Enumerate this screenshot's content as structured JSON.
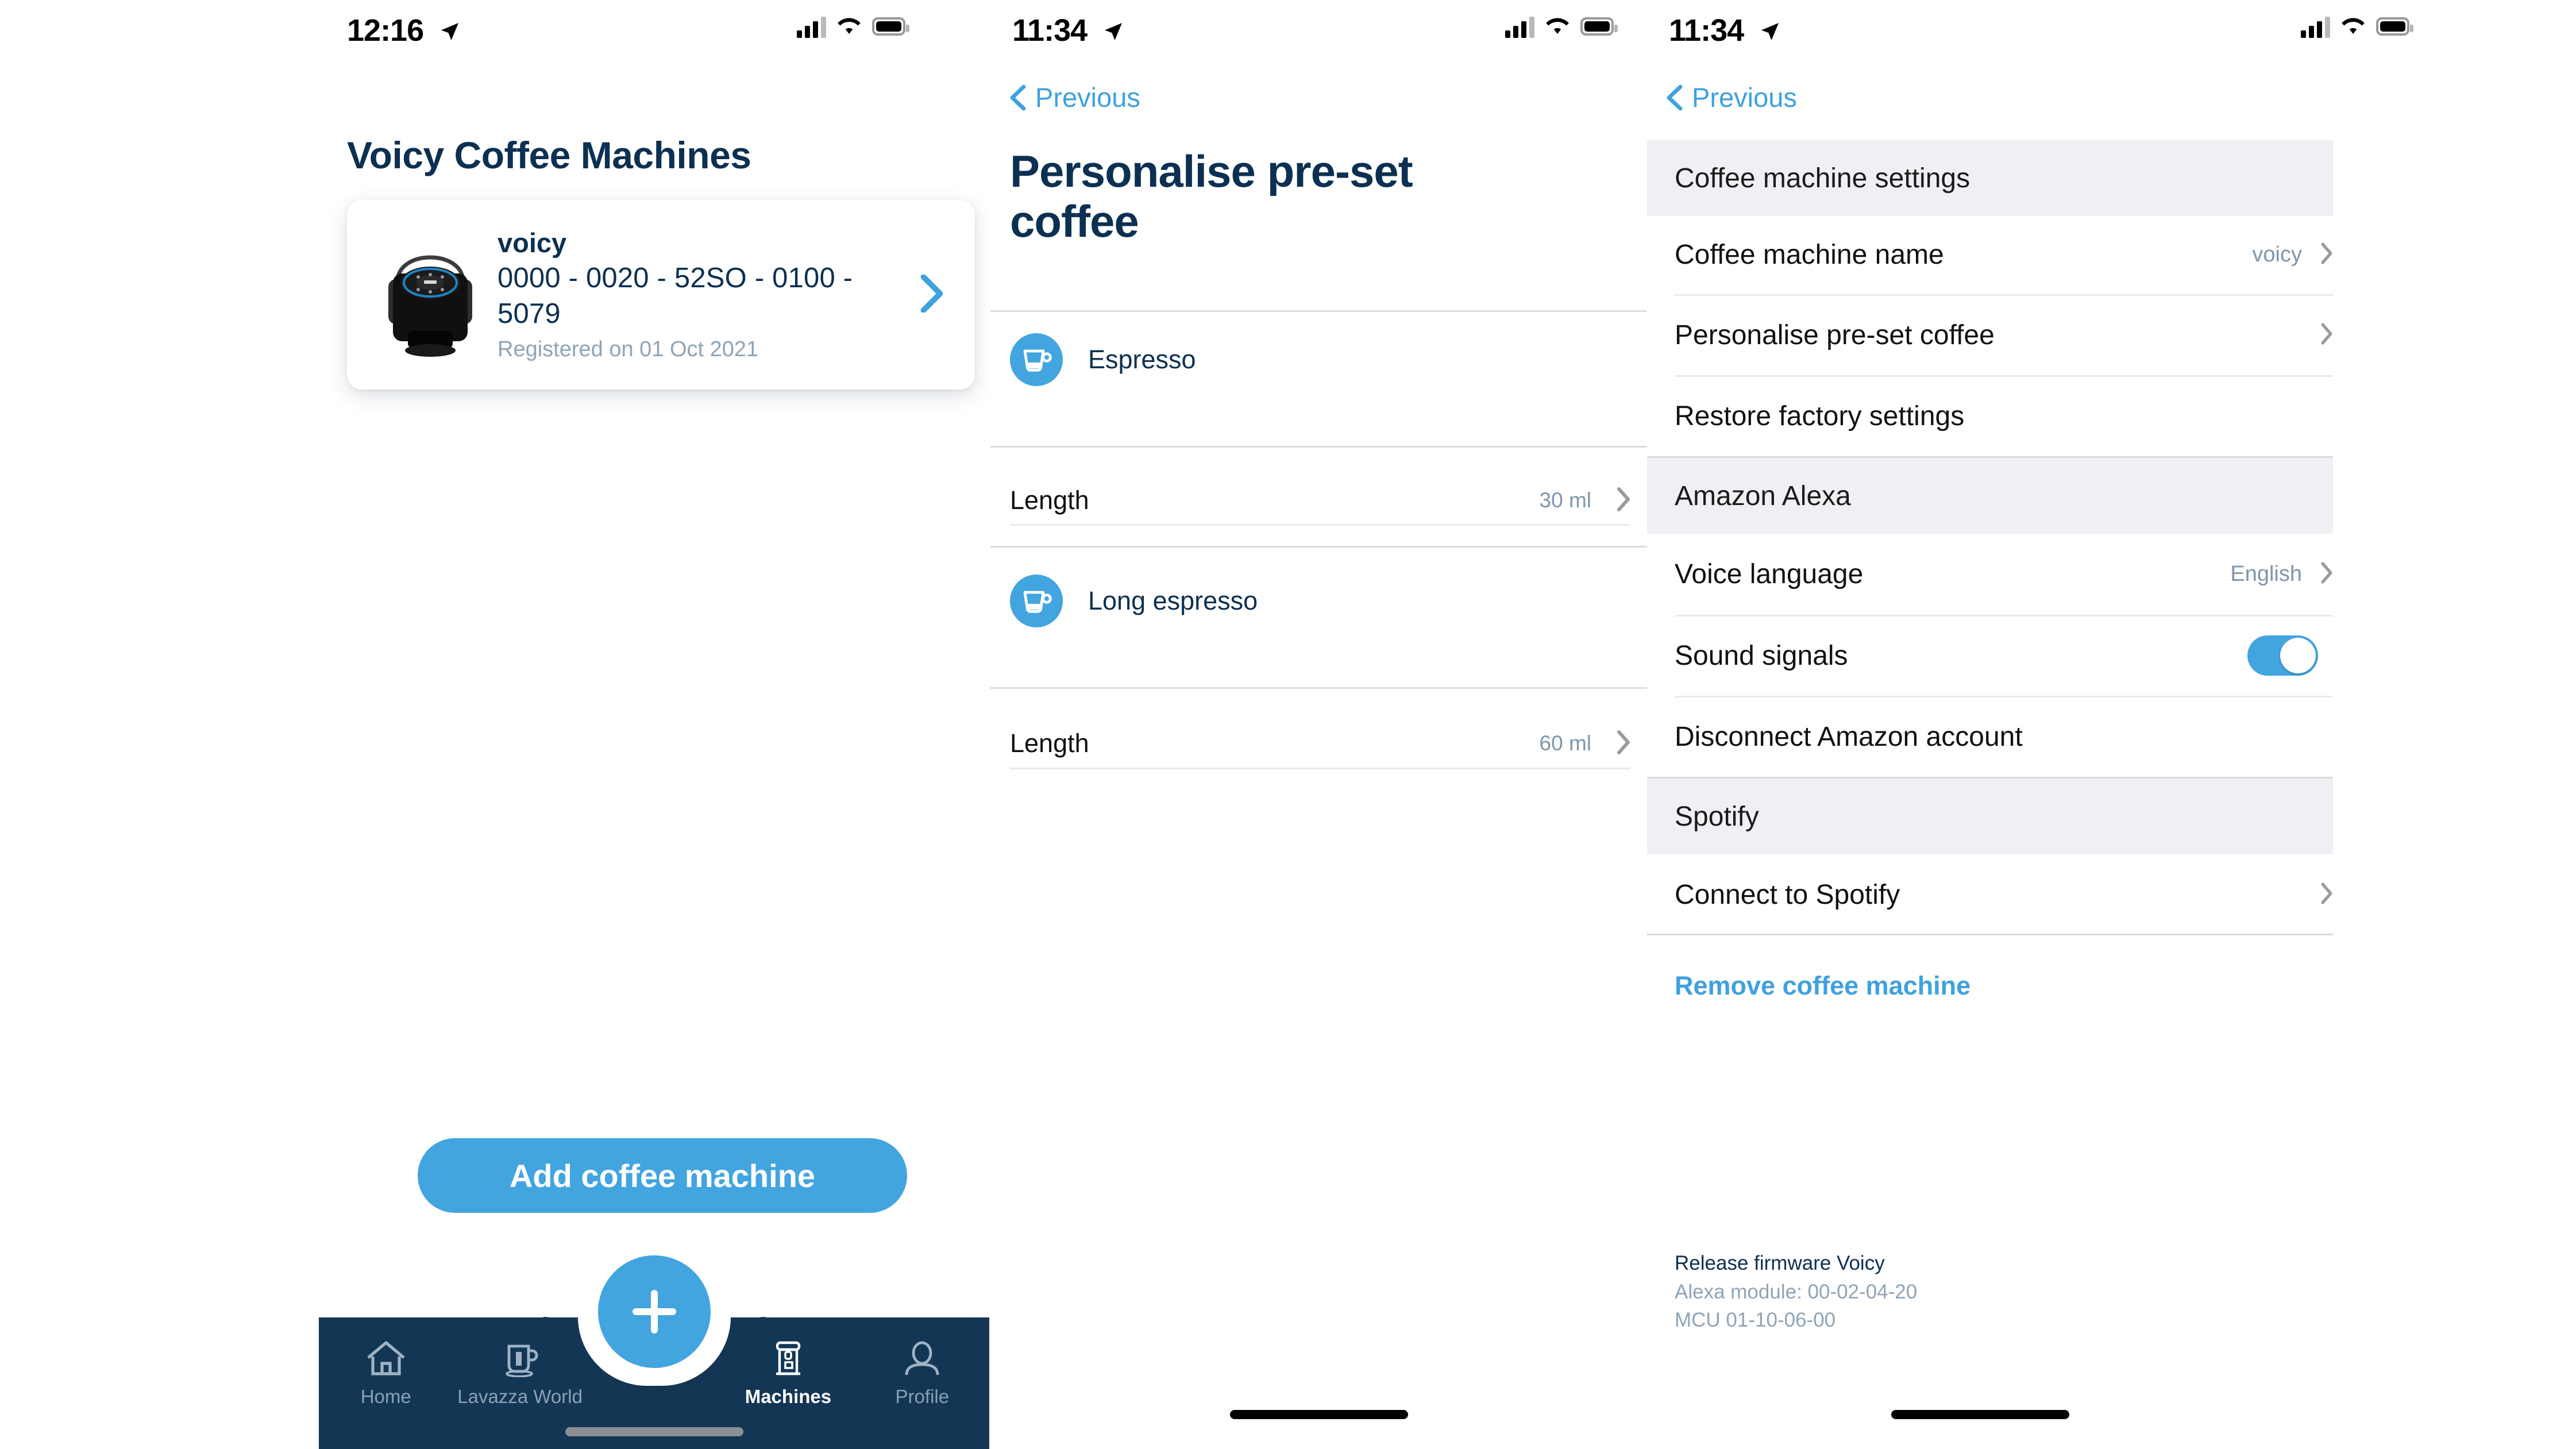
{
  "panel1": {
    "statusbar": {
      "time": "12:16",
      "location_icon": "location-arrow-icon",
      "cellular_icon": "cellular-signal-icon",
      "wifi_icon": "wifi-icon",
      "battery_icon": "battery-icon"
    },
    "title": "Voicy Coffee Machines",
    "machine_card": {
      "image_alt": "lavazza-voicy-machine",
      "name": "voicy",
      "serial": "0000 - 0020 - 52SO - 0100 - 5079",
      "registered": "Registered on 01 Oct 2021",
      "chevron": "chevron-right-icon"
    },
    "add_button": "Add coffee machine",
    "fab": "add-icon",
    "tabs": [
      {
        "label": "Home",
        "icon": "home-icon",
        "active": false
      },
      {
        "label": "Lavazza World",
        "icon": "coffee-cup-icon",
        "active": false
      },
      {
        "label": "Machines",
        "icon": "coffee-machine-icon",
        "active": true
      },
      {
        "label": "Profile",
        "icon": "person-icon",
        "active": false
      }
    ]
  },
  "panel2": {
    "statusbar": {
      "time": "11:34",
      "location_icon": "location-arrow-icon"
    },
    "back_label": "Previous",
    "title": "Personalise pre-set coffee",
    "drinks": [
      {
        "name": "Espresso",
        "icon": "espresso-cup-icon",
        "length_label": "Length",
        "length_value": "30 ml",
        "chevron": "chevron-right-icon"
      },
      {
        "name": "Long espresso",
        "icon": "espresso-cup-icon",
        "length_label": "Length",
        "length_value": "60 ml",
        "chevron": "chevron-right-icon"
      }
    ]
  },
  "panel3": {
    "statusbar": {
      "time": "11:34",
      "location_icon": "location-arrow-icon"
    },
    "back_label": "Previous",
    "sections": [
      {
        "header": "Coffee machine settings",
        "rows": [
          {
            "label": "Coffee machine name",
            "value": "voicy",
            "control": "chevron"
          },
          {
            "label": "Personalise pre-set coffee",
            "value": "",
            "control": "chevron"
          },
          {
            "label": "Restore factory settings",
            "value": "",
            "control": "none"
          }
        ]
      },
      {
        "header": "Amazon Alexa",
        "rows": [
          {
            "label": "Voice language",
            "value": "English",
            "control": "chevron"
          },
          {
            "label": "Sound signals",
            "value": "",
            "control": "toggle",
            "toggle_on": true
          },
          {
            "label": "Disconnect Amazon account",
            "value": "",
            "control": "none"
          }
        ]
      },
      {
        "header": "Spotify",
        "rows": [
          {
            "label": "Connect to Spotify",
            "value": "",
            "control": "chevron"
          }
        ]
      }
    ],
    "remove_link": "Remove coffee machine",
    "firmware": {
      "title": "Release firmware Voicy",
      "alexa": "Alexa module: 00-02-04-20",
      "mcu": "MCU 01-10-06-00"
    }
  },
  "colors": {
    "accent_blue": "#42a5e0",
    "dark_navy": "#0b3052",
    "tabbar_navy": "#133655",
    "muted": "#8ea4b8",
    "section_bg": "#f0f0f4"
  }
}
